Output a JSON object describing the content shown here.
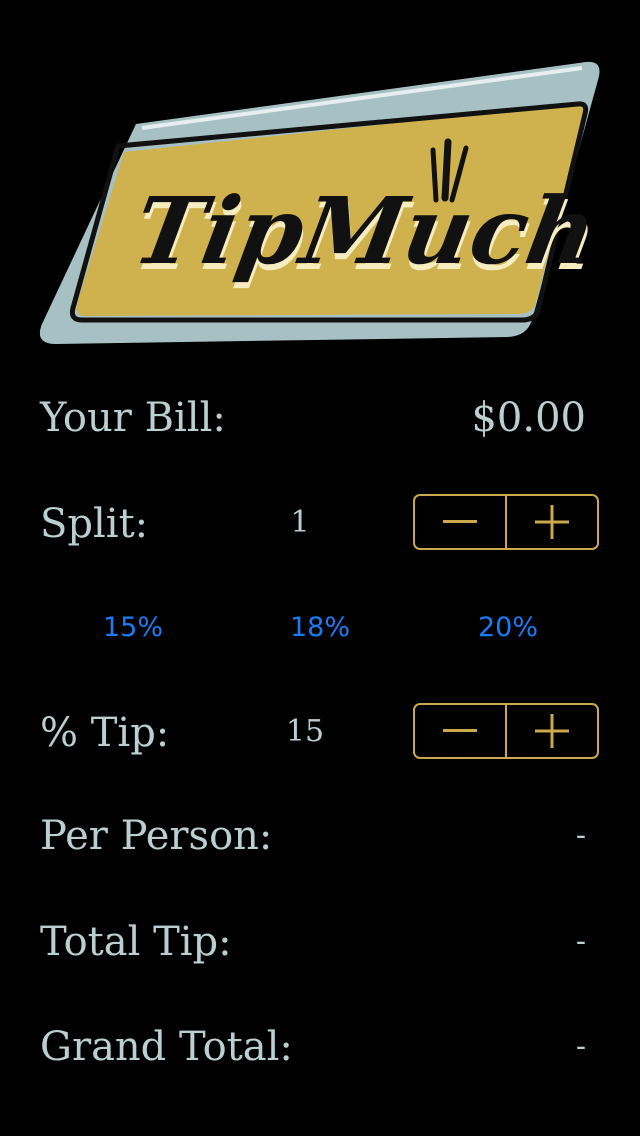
{
  "logo": {
    "text": "TipMuch",
    "colors": {
      "outer": "#a7c0c4",
      "inner": "#cfb24d",
      "outline": "#111111",
      "highlight": "#f5ecc0"
    }
  },
  "bill": {
    "label": "Your Bill:",
    "value": "$0.00"
  },
  "split": {
    "label": "Split:",
    "value": "1",
    "decrement_icon": "minus-icon",
    "increment_icon": "plus-icon"
  },
  "presets": [
    "15%",
    "18%",
    "20%"
  ],
  "tip": {
    "label": "% Tip:",
    "value": "15",
    "decrement_icon": "minus-icon",
    "increment_icon": "plus-icon"
  },
  "results": {
    "per_person_label": "Per Person:",
    "per_person_value": "-",
    "total_tip_label": "Total Tip:",
    "total_tip_value": "-",
    "grand_total_label": "Grand Total:",
    "grand_total_value": "-"
  },
  "colors": {
    "background": "#000000",
    "text": "#b9cfd0",
    "accent": "#c9a94a",
    "link": "#1a7cf5"
  }
}
